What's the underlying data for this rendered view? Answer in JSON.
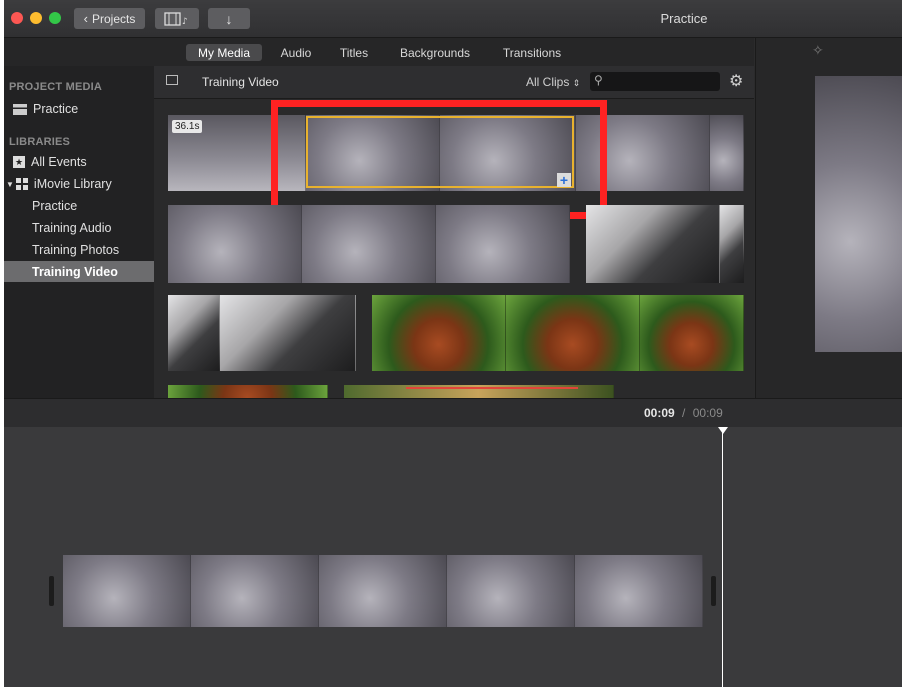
{
  "window": {
    "title": "Practice"
  },
  "toolbar": {
    "projects_label": "Projects",
    "media_icon": "filmstrip-music-icon",
    "import_icon": "down-arrow-icon"
  },
  "tabs": [
    {
      "label": "My Media",
      "active": true
    },
    {
      "label": "Audio",
      "active": false
    },
    {
      "label": "Titles",
      "active": false
    },
    {
      "label": "Backgrounds",
      "active": false
    },
    {
      "label": "Transitions",
      "active": false
    }
  ],
  "sidebar": {
    "project_media_heading": "PROJECT MEDIA",
    "project_item": "Practice",
    "libraries_heading": "LIBRARIES",
    "items": [
      {
        "label": "All Events"
      },
      {
        "label": "iMovie Library"
      },
      {
        "label": "Practice"
      },
      {
        "label": "Training Audio"
      },
      {
        "label": "Training Photos"
      },
      {
        "label": "Training Video",
        "selected": true
      }
    ]
  },
  "browser": {
    "event_title": "Training Video",
    "filter_label": "All Clips",
    "search_placeholder": "",
    "first_clip_duration": "36.1s"
  },
  "timeline": {
    "current_time": "00:09",
    "separator": "/",
    "total_time": "00:09"
  },
  "colors": {
    "highlight": "#f22",
    "selection": "#e8b22e",
    "playhead": "#ffffff"
  }
}
